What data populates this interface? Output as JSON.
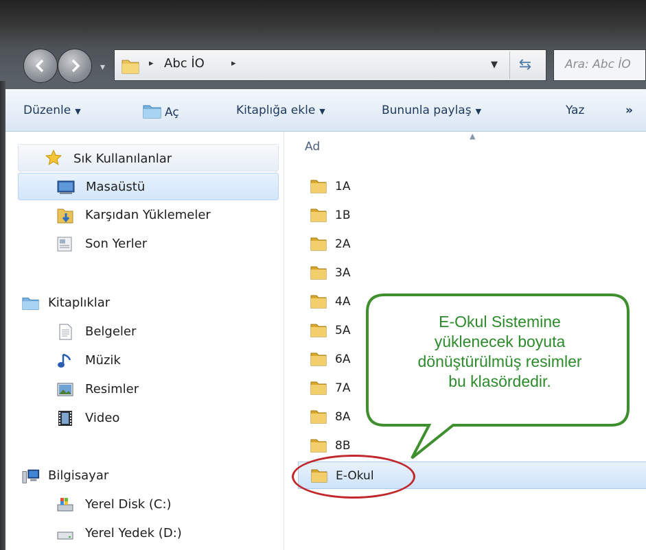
{
  "nav": {
    "back_icon": "back-arrow-icon",
    "forward_icon": "forward-arrow-icon"
  },
  "address": {
    "crumb": "Abc İO",
    "sep": "▸"
  },
  "search": {
    "placeholder": "Ara: Abc İO"
  },
  "toolbar": {
    "edit": "Düzenle",
    "open": "Aç",
    "add_library": "Kitaplığa ekle",
    "share": "Bununla paylaş",
    "print": "Yaz",
    "more": "»",
    "dropdown_arrow": "▼"
  },
  "sidebar": {
    "favorites": "Sık Kullanılanlar",
    "desktop": "Masaüstü",
    "downloads": "Karşıdan Yüklemeler",
    "recent": "Son Yerler",
    "libraries": "Kitaplıklar",
    "documents": "Belgeler",
    "music": "Müzik",
    "pictures": "Resimler",
    "videos": "Video",
    "computer": "Bilgisayar",
    "local_disk": "Yerel Disk (C:)",
    "backup_disk": "Yerel Yedek (D:)"
  },
  "content": {
    "column_name": "Ad",
    "folders": [
      "1A",
      "1B",
      "2A",
      "3A",
      "4A",
      "5A",
      "6A",
      "7A",
      "8A",
      "8B"
    ],
    "selected_folder": "E-Okul"
  },
  "callout": {
    "line1": "E-Okul Sistemine",
    "line2": "yüklenecek boyuta",
    "line3": "dönüştürülmüş resimler",
    "line4": "bu klasördedir."
  },
  "colors": {
    "callout_border": "#3f8f2e",
    "callout_text": "#2c8a2c",
    "highlight_ring": "#c0282d",
    "selection": "#cfe3fa"
  }
}
